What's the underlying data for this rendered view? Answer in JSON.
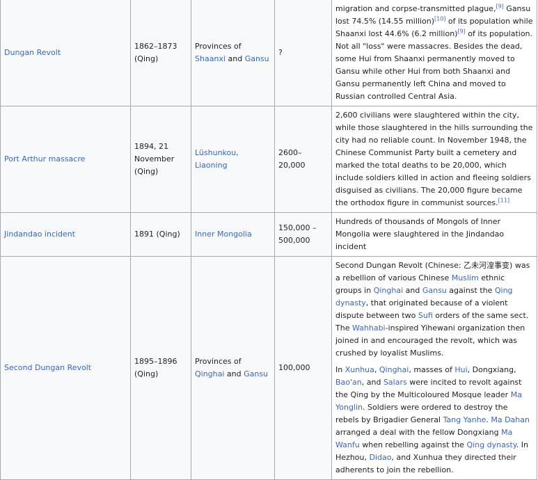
{
  "rows": [
    {
      "event": "Dungan Revolt",
      "date": "1862–1873 (Qing)",
      "location": [
        {
          "t": "Provinces of "
        },
        {
          "t": "Shaanxi",
          "link": true
        },
        {
          "t": " and "
        },
        {
          "t": "Gansu",
          "link": true
        }
      ],
      "deaths": "?",
      "description": [
        [
          {
            "t": "migration and corpse-transmitted plague,"
          },
          {
            "t": "[9]",
            "ref": true
          },
          {
            "t": " Gansu lost 74.5% (14.55 million)"
          },
          {
            "t": "[10]",
            "ref": true
          },
          {
            "t": " of its population while Shaanxi lost 44.6% (6.2 million)"
          },
          {
            "t": "[9]",
            "ref": true
          },
          {
            "t": " of its population. Not all \"loss\" were massacres. Besides the dead, some Hui from Shaanxi permanently moved to Gansu while other Hui from both Shaanxi and Gansu permanently left China and moved to Russian controlled Central Asia."
          }
        ]
      ]
    },
    {
      "event": "Port Arthur massacre",
      "date": "1894, 21 November (Qing)",
      "location": [
        {
          "t": "Lüshunkou, Liaoning",
          "link": true
        }
      ],
      "deaths": "2600–20,000",
      "description": [
        [
          {
            "t": "2,600 civilians were slaughtered within the city, while those slaughtered in the hills surrounding the city had no reliable count. In November 1948, the Chinese Communist Party built a cemetery and marked the total deaths to be 20,000, which include soldiers killed in action and fleeing soldiers disguised as civilians. The 20,000 figure became the orthodox figure in communist sources."
          },
          {
            "t": "[11]",
            "ref": true
          }
        ]
      ]
    },
    {
      "event": "Jindandao incident",
      "date": "1891 (Qing)",
      "location": [
        {
          "t": "Inner Mongolia",
          "link": true
        }
      ],
      "deaths": "150,000 – 500,000",
      "description": [
        [
          {
            "t": "Hundreds of thousands of Mongols of Inner Mongolia were slaughtered in the Jindandao incident"
          }
        ]
      ]
    },
    {
      "event": "Second Dungan Revolt",
      "date": "1895–1896 (Qing)",
      "location": [
        {
          "t": "Provinces of "
        },
        {
          "t": "Qinghai",
          "link": true
        },
        {
          "t": " and "
        },
        {
          "t": "Gansu",
          "link": true
        }
      ],
      "deaths": "100,000",
      "description": [
        [
          {
            "t": "Second Dungan Revolt (Chinese: 乙未河湟事变) was a rebellion of various Chinese "
          },
          {
            "t": "Muslim",
            "link": true
          },
          {
            "t": " ethnic groups in "
          },
          {
            "t": "Qinghai",
            "link": true
          },
          {
            "t": " and "
          },
          {
            "t": "Gansu",
            "link": true
          },
          {
            "t": " against the "
          },
          {
            "t": "Qing dynasty",
            "link": true
          },
          {
            "t": ", that originated because of a violent dispute between two "
          },
          {
            "t": "Sufi",
            "link": true
          },
          {
            "t": " orders of the same sect. The "
          },
          {
            "t": "Wahhabi",
            "link": true
          },
          {
            "t": "-inspired Yihewani organization then joined in and encouraged the revolt, which was crushed by loyalist Muslims."
          }
        ],
        [
          {
            "t": "In "
          },
          {
            "t": "Xunhua",
            "link": true
          },
          {
            "t": ", "
          },
          {
            "t": "Qinghai",
            "link": true
          },
          {
            "t": ", masses of "
          },
          {
            "t": "Hui",
            "link": true
          },
          {
            "t": ", Dongxiang, "
          },
          {
            "t": "Bao'an",
            "link": true
          },
          {
            "t": ", and "
          },
          {
            "t": "Salars",
            "link": true
          },
          {
            "t": " were incited to revolt against the Qing by the Multicoloured Mosque leader "
          },
          {
            "t": "Ma Yonglin",
            "link": true
          },
          {
            "t": ". Soldiers were ordered to destroy the rebels by Brigadier General "
          },
          {
            "t": "Tang Yanhe",
            "link": true
          },
          {
            "t": ". "
          },
          {
            "t": "Ma Dahan",
            "link": true
          },
          {
            "t": " arranged a deal with the fellow Dongxiang "
          },
          {
            "t": "Ma Wanfu",
            "link": true
          },
          {
            "t": " when rebelling against the "
          },
          {
            "t": "Qing dynasty",
            "link": true
          },
          {
            "t": ". In Hezhou, "
          },
          {
            "t": "Didao",
            "link": true
          },
          {
            "t": ", and Xunhua they directed their adherents to join the rebellion."
          }
        ]
      ]
    }
  ]
}
